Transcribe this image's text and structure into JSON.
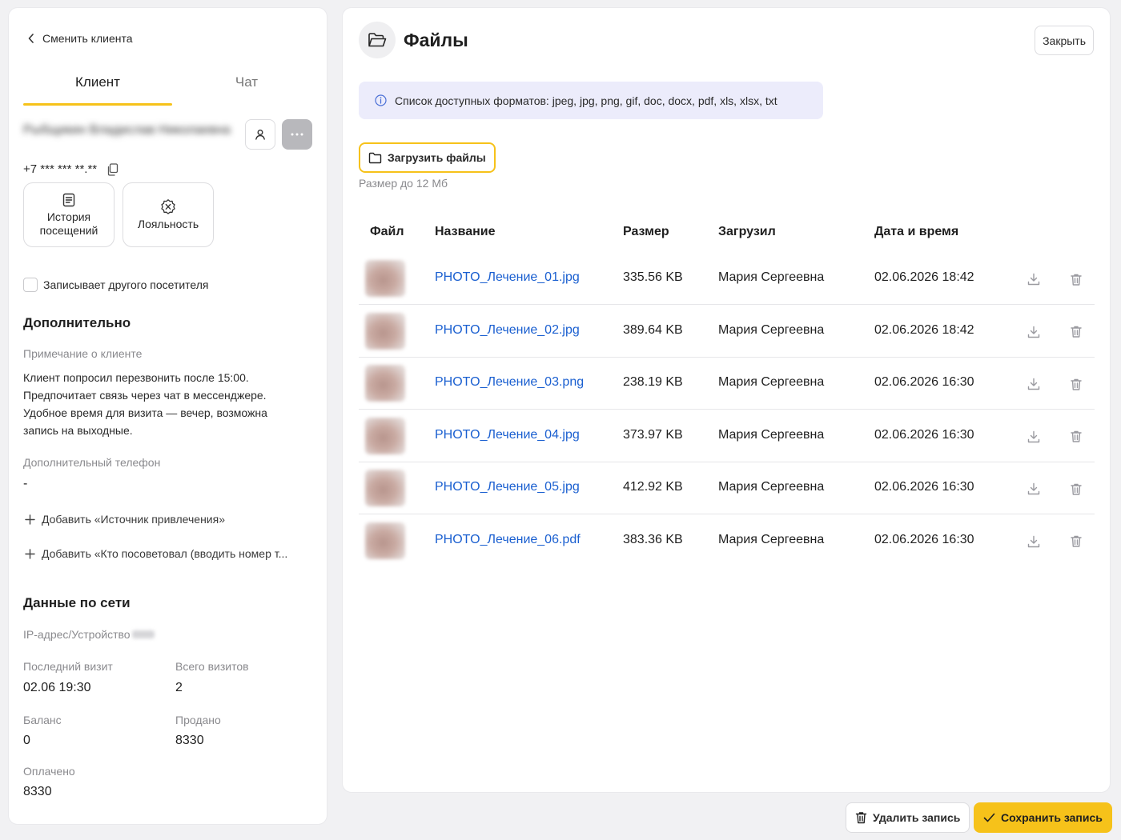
{
  "sidebar": {
    "back_label": "Сменить клиента",
    "tabs": [
      {
        "label": "Клиент",
        "active": true
      },
      {
        "label": "Чат",
        "active": false
      }
    ],
    "client_name": "Рыбщикин Владислав Николаевна",
    "phone": "+7 *** *** **.**",
    "tiles": {
      "history": "История посещений",
      "loyalty": "Лояльность"
    },
    "other_visitor_label": "Записывает другого посетителя",
    "additional": {
      "title": "Дополнительно",
      "note_label": "Примечание о клиенте",
      "note_text": "Клиент попросил перезвонить после 15:00. Предпочитает связь через чат в мессенджере. Удобное время для визита — вечер, возможна запись на выходные.",
      "extra_phone_label": "Дополнительный телефон",
      "extra_phone_value": "-",
      "add_source": "Добавить «Источник привлечения»",
      "add_referrer": "Добавить «Кто посоветовал (вводить номер т..."
    },
    "network": {
      "title": "Данные по сети",
      "ip_label": "IP-адрес/Устройство",
      "last_visit_label": "Последний визит",
      "last_visit_value": "02.06 19:30",
      "total_visits_label": "Всего визитов",
      "total_visits_value": "2",
      "balance_label": "Баланс",
      "balance_value": "0",
      "sold_label": "Продано",
      "sold_value": "8330",
      "paid_label": "Оплачено",
      "paid_value": "8330"
    }
  },
  "files": {
    "title": "Файлы",
    "close_label": "Закрыть",
    "formats_info": "Список доступных форматов: jpeg, jpg, png, gif, doc, docx, pdf, xls, xlsx, txt",
    "upload_label": "Загрузить файлы",
    "size_hint": "Размер до 12 Мб",
    "columns": [
      "Файл",
      "Название",
      "Размер",
      "Загрузил",
      "Дата и время"
    ],
    "rows": [
      {
        "name": "PHOTO_Лечение_01.jpg",
        "size": "335.56 KB",
        "uploader": "Мария Сергеевна",
        "date": "02.06.2026 18:42"
      },
      {
        "name": "PHOTO_Лечение_02.jpg",
        "size": "389.64 KB",
        "uploader": "Мария Сергеевна",
        "date": "02.06.2026 18:42"
      },
      {
        "name": "PHOTO_Лечение_03.png",
        "size": "238.19 KB",
        "uploader": "Мария Сергеевна",
        "date": "02.06.2026 16:30"
      },
      {
        "name": "PHOTO_Лечение_04.jpg",
        "size": "373.97 KB",
        "uploader": "Мария Сергеевна",
        "date": "02.06.2026 16:30"
      },
      {
        "name": "PHOTO_Лечение_05.jpg",
        "size": "412.92 KB",
        "uploader": "Мария Сергеевна",
        "date": "02.06.2026 16:30"
      },
      {
        "name": "PHOTO_Лечение_06.pdf",
        "size": "383.36 KB",
        "uploader": "Мария Сергеевна",
        "date": "02.06.2026 16:30"
      }
    ]
  },
  "footer": {
    "delete_label": "Удалить запись",
    "save_label": "Сохранить запись"
  },
  "colors": {
    "accent": "#f6c21a",
    "link": "#1a5fd0",
    "info_bg": "#ececfb"
  }
}
